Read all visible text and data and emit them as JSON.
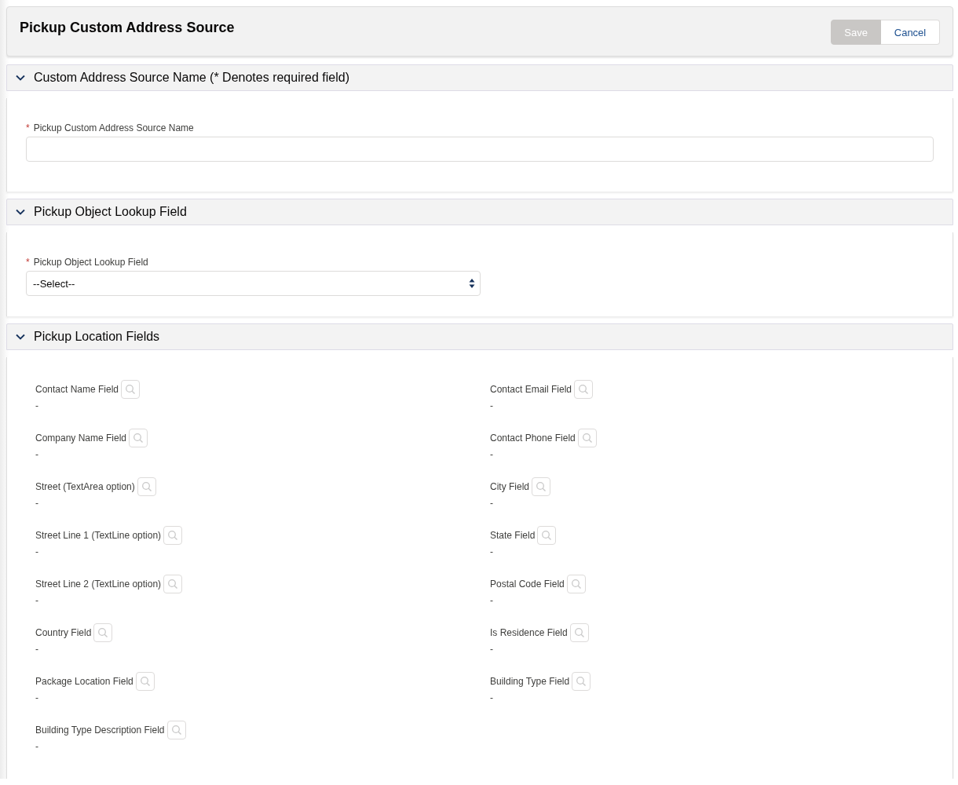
{
  "header": {
    "title": "Pickup Custom Address Source",
    "buttons": [
      {
        "label": "Save",
        "kind": "brand",
        "disabled": true
      },
      {
        "label": "Cancel",
        "kind": "neutral",
        "disabled": false
      }
    ]
  },
  "sections": [
    {
      "title": "Custom Address Source Name (* Denotes required field)",
      "expanded": true,
      "kind": "text",
      "field": {
        "label": "Pickup Custom Address Source Name",
        "required_mark": "*"
      }
    },
    {
      "title": "Pickup Object Lookup Field",
      "expanded": true,
      "kind": "select",
      "field": {
        "label": "Pickup Object Lookup Field",
        "required_mark": "*",
        "value": "--Select--"
      }
    },
    {
      "title": "Pickup Location Fields",
      "expanded": true,
      "kind": "lookups",
      "fields": [
        {
          "label": "Contact Name Field",
          "value": "-"
        },
        {
          "label": "Contact Email Field",
          "value": "-"
        },
        {
          "label": "Company Name Field",
          "value": "-"
        },
        {
          "label": "Contact Phone Field",
          "value": "-"
        },
        {
          "label": "Street (TextArea option)",
          "value": "-"
        },
        {
          "label": "City Field",
          "value": "-"
        },
        {
          "label": "Street Line 1 (TextLine option)",
          "value": "-"
        },
        {
          "label": "State Field",
          "value": "-"
        },
        {
          "label": "Street Line 2 (TextLine option)",
          "value": "-"
        },
        {
          "label": "Postal Code Field",
          "value": "-"
        },
        {
          "label": "Country Field",
          "value": "-"
        },
        {
          "label": "Is Residence Field",
          "value": "-"
        },
        {
          "label": "Package Location Field",
          "value": "-"
        },
        {
          "label": "Building Type Field",
          "value": "-"
        },
        {
          "label": "Building Type Description Field",
          "value": "-"
        }
      ]
    }
  ]
}
